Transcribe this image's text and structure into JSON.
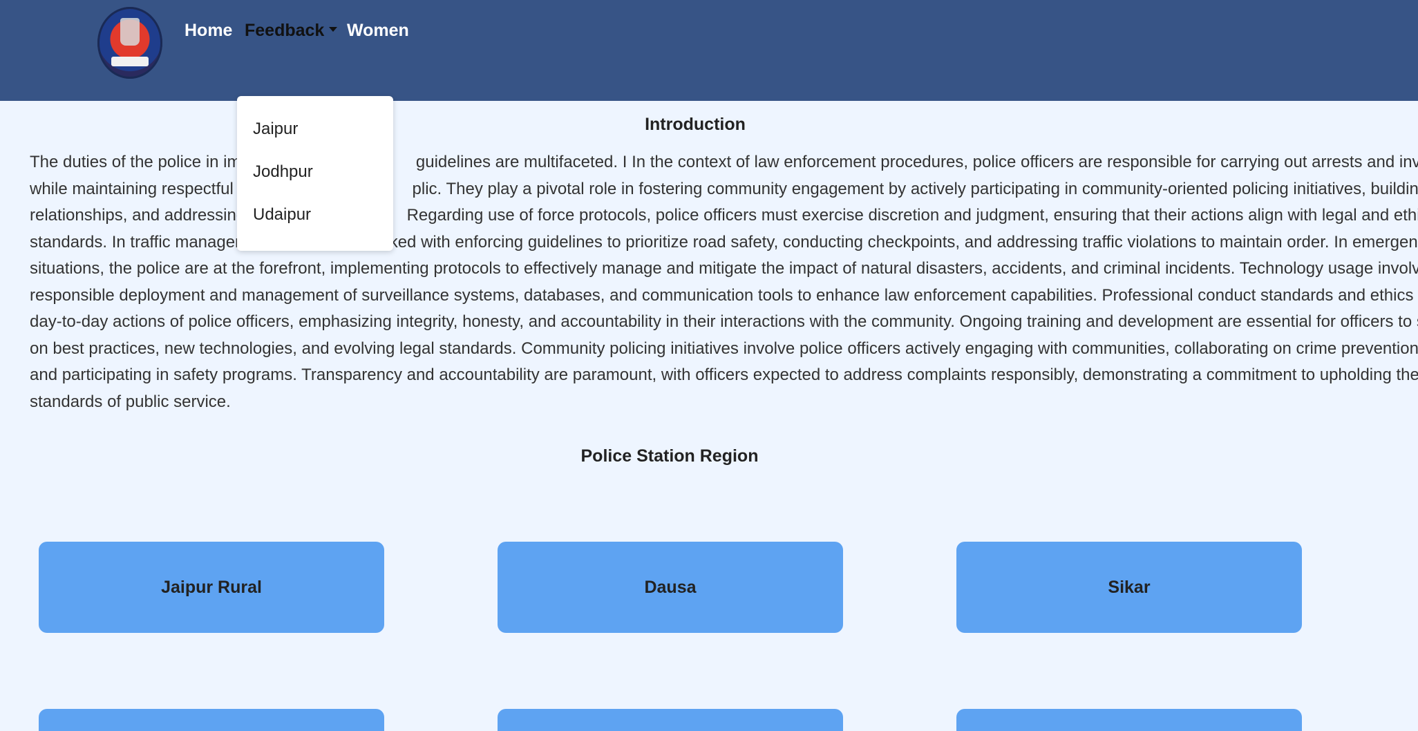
{
  "navbar": {
    "links": [
      {
        "label": "Home"
      },
      {
        "label": "Feedback"
      },
      {
        "label": "Women"
      }
    ],
    "bg_color": "#375486"
  },
  "dropdown": {
    "items": [
      {
        "label": "Jaipur"
      },
      {
        "label": "Jodhpur"
      },
      {
        "label": "Udaipur"
      }
    ]
  },
  "intro": {
    "title": "Introduction",
    "lines": [
      "The duties of the police in imp                                    guidelines are multifaceted. I In the context of law enforcement procedures, police officers are responsible for carrying out arrests and investigation",
      "while maintaining respectful in                                   plic. They play a pivotal role in fostering community engagement by actively participating in community-oriented policing initiatives, building positive",
      "relationships, and addressing                                   Regarding use of force protocols, police officers must exercise discretion and judgment, ensuring that their actions align with legal and ethical",
      "standards. In traffic management, officers are tasked with enforcing guidelines to prioritize road safety, conducting checkpoints, and addressing traffic violations to maintain order. In emergency respon",
      "situations, the police are at the forefront, implementing protocols to effectively manage and mitigate the impact of natural disasters, accidents, and criminal incidents. Technology usage involves the",
      "responsible deployment and management of surveillance systems, databases, and communication tools to enhance law enforcement capabilities. Professional conduct standards and ethics guide the",
      "day-to-day actions of police officers, emphasizing integrity, honesty, and accountability in their interactions with the community. Ongoing training and development are essential for officers to stay upda",
      "on best practices, new technologies, and evolving legal standards. Community policing initiatives involve police officers actively engaging with communities, collaborating on crime prevention strategie",
      "and participating in safety programs. Transparency and accountability are paramount, with officers expected to address complaints responsibly, demonstrating a commitment to upholding the highest",
      "standards of public service."
    ]
  },
  "region": {
    "title": "Police Station Region",
    "buttons": [
      {
        "label": "Jaipur Rural"
      },
      {
        "label": "Dausa"
      },
      {
        "label": "Sikar"
      },
      {
        "label": ""
      },
      {
        "label": ""
      },
      {
        "label": ""
      }
    ],
    "button_color": "#5ea3f2"
  }
}
